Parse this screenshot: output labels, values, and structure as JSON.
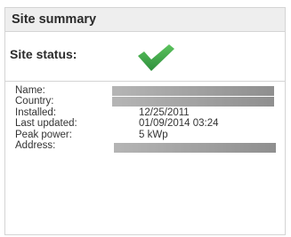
{
  "panel": {
    "title": "Site summary"
  },
  "status": {
    "label": "Site status:",
    "icon": "checkmark-icon",
    "icon_color": "#3aa54a"
  },
  "details": [
    {
      "label": "Name:",
      "value": null,
      "redacted": true
    },
    {
      "label": "Country:",
      "value": null,
      "redacted": true
    },
    {
      "label": "Installed:",
      "value": "12/25/2011",
      "redacted": false
    },
    {
      "label": "Last updated:",
      "value": "01/09/2014 03:24",
      "redacted": false
    },
    {
      "label": "Peak power:",
      "value": "5 kWp",
      "redacted": false
    },
    {
      "label": "Address:",
      "value": null,
      "redacted": true
    }
  ]
}
